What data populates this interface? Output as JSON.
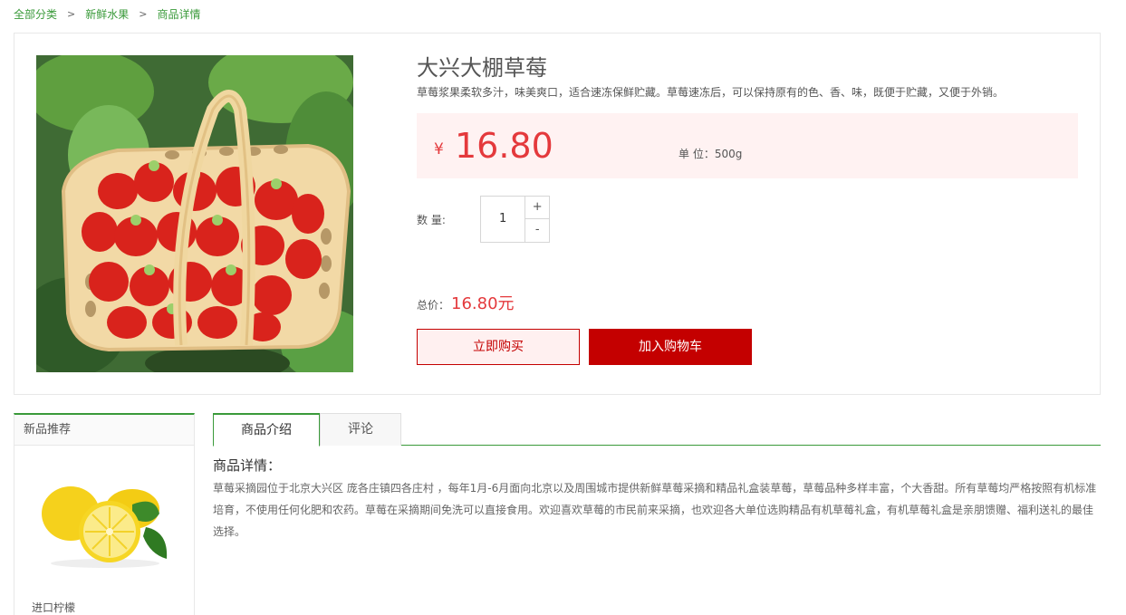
{
  "breadcrumb": {
    "items": [
      "全部分类",
      "新鲜水果",
      "商品详情"
    ],
    "separator": ">"
  },
  "product": {
    "image_alt": "strawberries-in-basket",
    "title": "大兴大棚草莓",
    "description": "草莓浆果柔软多汁，味美爽口，适合速冻保鲜贮藏。草莓速冻后，可以保持原有的色、香、味，既便于贮藏，又便于外销。",
    "currency_symbol": "¥",
    "price": "16.80",
    "unit_label": "单 位：",
    "unit_value": "500g",
    "quantity_label": "数 量:",
    "quantity": "1",
    "qty_plus": "+",
    "qty_minus": "-",
    "total_label": "总价：",
    "total_value": "16.80元",
    "buy_now_label": "立即购买",
    "add_cart_label": "加入购物车"
  },
  "new_products": {
    "heading": "新品推荐",
    "items": [
      {
        "name": "进口柠檬"
      }
    ]
  },
  "tabs": [
    {
      "label": "商品介绍",
      "active": true
    },
    {
      "label": "评论",
      "active": false
    }
  ],
  "detail": {
    "title": "商品详情：",
    "text": "草莓采摘园位于北京大兴区 庞各庄镇四各庄村 ，每年1月-6月面向北京以及周围城市提供新鲜草莓采摘和精品礼盒装草莓，草莓品种多样丰富，个大香甜。所有草莓均严格按照有机标准培育，不使用任何化肥和农药。草莓在采摘期间免洗可以直接食用。欢迎喜欢草莓的市民前来采摘，也欢迎各大单位选购精品有机草莓礼盒，有机草莓礼盒是亲朋馈赠、福利送礼的最佳选择。"
  },
  "colors": {
    "accent_green": "#3a9a3a",
    "price_red": "#e4393c",
    "cart_red": "#c40000"
  }
}
